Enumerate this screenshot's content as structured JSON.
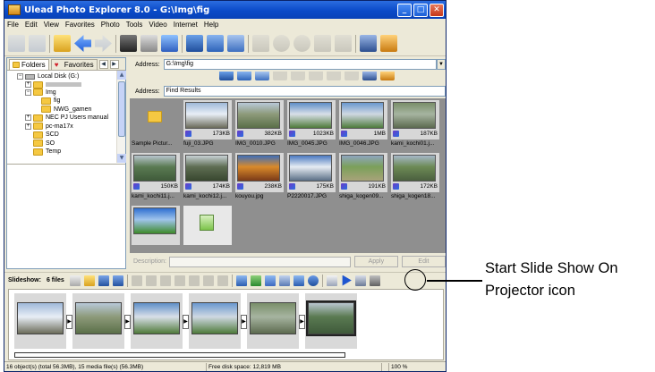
{
  "window": {
    "title": "Ulead Photo Explorer 8.0 - G:\\Img\\fig",
    "buttons": [
      "minimize",
      "maximize",
      "close"
    ]
  },
  "menu": [
    "File",
    "Edit",
    "View",
    "Favorites",
    "Photo",
    "Tools",
    "Video",
    "Internet",
    "Help"
  ],
  "toolbar_icons": [
    "open-icon",
    "import-icon",
    "browse-folder-icon",
    "back-icon",
    "forward-icon",
    "camera-icon",
    "scanner-icon",
    "filters-icon",
    "thumbnail-view-icon",
    "image-view-icon",
    "details-view-icon",
    "compare-icon",
    "rotate-left-icon",
    "rotate-right-icon",
    "batch-icon",
    "print-icon",
    "email-icon",
    "slideshow-icon"
  ],
  "left_panel": {
    "tabs": [
      {
        "icon": "folder-icon",
        "label": "Folders"
      },
      {
        "icon": "heart-icon",
        "label": "Favorites"
      }
    ],
    "tree": [
      {
        "label": "Local Disk (G:)",
        "indent": 1,
        "expander": "-",
        "icon": "drive-icon"
      },
      {
        "label": "",
        "indent": 2,
        "expander": "+",
        "icon": "folder-icon"
      },
      {
        "label": "Img",
        "indent": 2,
        "expander": "-",
        "icon": "folder-icon"
      },
      {
        "label": "fig",
        "indent": 3,
        "expander": "",
        "icon": "folder-icon"
      },
      {
        "label": "NWG_gamen",
        "indent": 3,
        "expander": "",
        "icon": "folder-icon"
      },
      {
        "label": "NEC PJ Users manual",
        "indent": 2,
        "expander": "+",
        "icon": "folder-icon"
      },
      {
        "label": "pc-ma17x",
        "indent": 2,
        "expander": "+",
        "icon": "folder-icon"
      },
      {
        "label": "SCD",
        "indent": 2,
        "expander": "",
        "icon": "folder-icon"
      },
      {
        "label": "SO",
        "indent": 2,
        "expander": "",
        "icon": "folder-icon"
      },
      {
        "label": "Temp",
        "indent": 2,
        "expander": "",
        "icon": "folder-icon"
      }
    ]
  },
  "address_top": {
    "label": "Address:",
    "value": "G:\\Img\\fig"
  },
  "address_results": {
    "label": "Address:",
    "value": "Find Results"
  },
  "thumbnails": [
    {
      "name": "Sample Pictur...",
      "size": "",
      "kind": "folder"
    },
    {
      "name": "fuji_03.JPG",
      "size": "173KB",
      "kind": "photo",
      "colors": [
        "#9fb9d9",
        "#e8eef6",
        "#6b6b5a"
      ]
    },
    {
      "name": "IMG_0010.JPG",
      "size": "382KB",
      "kind": "photo",
      "colors": [
        "#b8c8d8",
        "#8d9a7a",
        "#5a6f48"
      ]
    },
    {
      "name": "IMG_0045.JPG",
      "size": "1023KB",
      "kind": "photo",
      "colors": [
        "#5f8fc8",
        "#d8dfe8",
        "#4f7a3a"
      ]
    },
    {
      "name": "IMG_0046.JPG",
      "size": "1MB",
      "kind": "photo",
      "colors": [
        "#6a98cf",
        "#cfd8e2",
        "#4e7b3b"
      ]
    },
    {
      "name": "kami_kochi01.j...",
      "size": "187KB",
      "kind": "photo",
      "colors": [
        "#7a8f6a",
        "#a6b4a0",
        "#5c6a4f"
      ]
    },
    {
      "name": "kami_kochi11.j...",
      "size": "150KB",
      "kind": "photo",
      "colors": [
        "#b9c6cf",
        "#5a7a52",
        "#3f5a3a"
      ]
    },
    {
      "name": "kami_kochi12.j...",
      "size": "174KB",
      "kind": "photo",
      "colors": [
        "#c9d2d6",
        "#5e6d52",
        "#38472f"
      ]
    },
    {
      "name": "kouyou.jpg",
      "size": "238KB",
      "kind": "photo",
      "colors": [
        "#3f6fb8",
        "#d98a2a",
        "#7a3a18"
      ]
    },
    {
      "name": "P2220017.JPG",
      "size": "175KB",
      "kind": "photo",
      "colors": [
        "#4a78c0",
        "#e6ecf3",
        "#5b6f86"
      ]
    },
    {
      "name": "shiga_kogen09...",
      "size": "191KB",
      "kind": "photo",
      "colors": [
        "#8fa6bf",
        "#7ba05a",
        "#a8a37a"
      ]
    },
    {
      "name": "shiga_kogen18...",
      "size": "172KB",
      "kind": "photo",
      "colors": [
        "#a7b8c9",
        "#6c8a55",
        "#4b5f3f"
      ]
    },
    {
      "name": "",
      "size": "",
      "kind": "photo",
      "colors": [
        "#2f6fd0",
        "#9fc4ec",
        "#3d8a2a"
      ]
    },
    {
      "name": "",
      "size": "",
      "kind": "document"
    }
  ],
  "description_bar": {
    "label": "Description:",
    "apply": "Apply",
    "edit": "Edit"
  },
  "slideshow": {
    "label": "Slideshow:",
    "count": "6 files",
    "icons": [
      "new-slideshow-icon",
      "open-slideshow-icon",
      "save-icon",
      "save-as-icon",
      "add-icon",
      "remove-icon",
      "transition-icon",
      "undo-icon",
      "redo-icon",
      "music-icon",
      "stop-icon",
      "preview-icon",
      "export-icon",
      "burn-icon",
      "settings-icon",
      "upload-icon",
      "share-icon",
      "play-icon",
      "start-slide-show-on-projector-icon",
      "more-icon"
    ]
  },
  "strip_colors": [
    [
      "#9fb9d9",
      "#e8eef6",
      "#6b6b5a"
    ],
    [
      "#b8c8d8",
      "#8d9a7a",
      "#5a6f48"
    ],
    [
      "#5f8fc8",
      "#d8dfe8",
      "#4f7a3a"
    ],
    [
      "#6a98cf",
      "#cfd8e2",
      "#4e7b3b"
    ],
    [
      "#7a8f6a",
      "#a6b4a0",
      "#5c6a4f"
    ],
    [
      "#b9c6cf",
      "#5a7a52",
      "#3f5a3a"
    ]
  ],
  "status": {
    "objects": "16 object(s) (total 56.3MB), 15 media file(s) (56.3MB)",
    "disk": "Free disk space: 12,819 MB",
    "zoom": "100 %"
  },
  "callout": {
    "text": "Start Slide Show On Projector icon"
  }
}
